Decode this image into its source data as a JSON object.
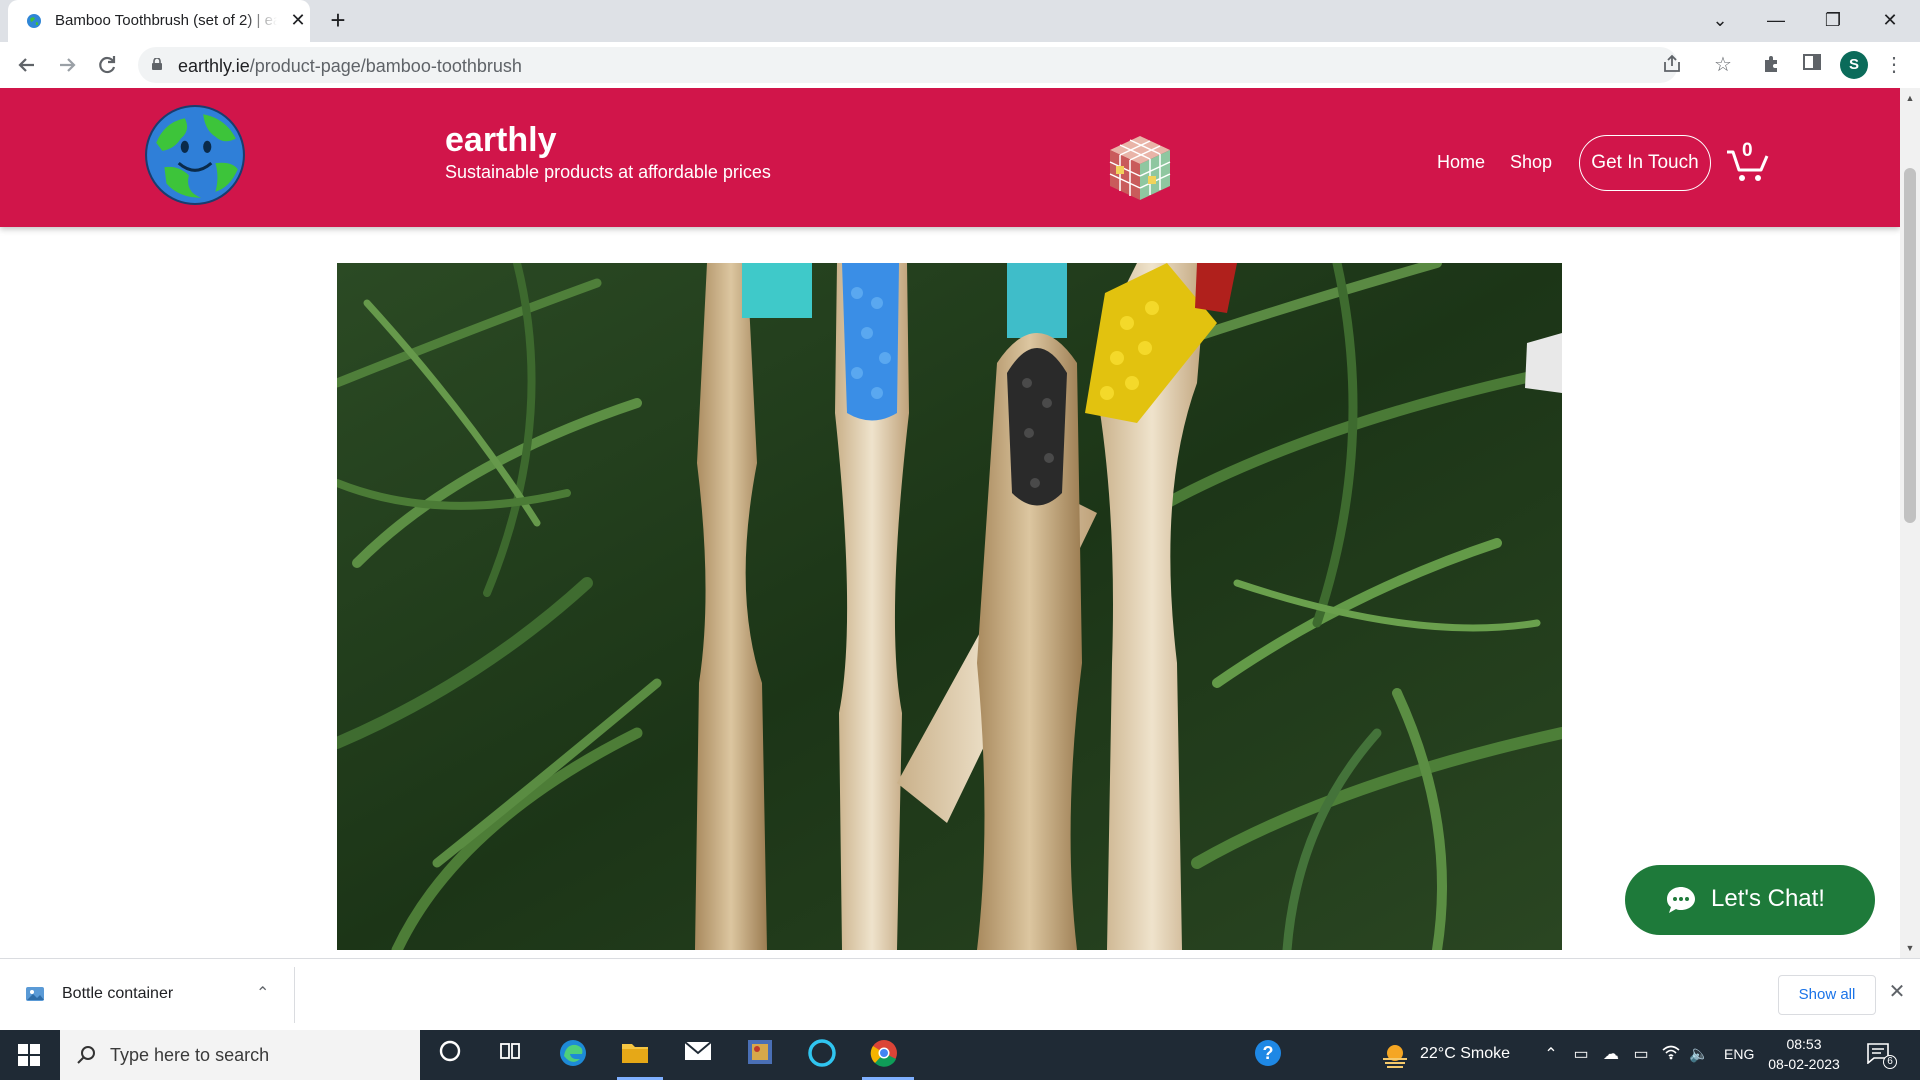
{
  "browser": {
    "tab_title": "Bamboo Toothbrush (set of 2) | earthly",
    "tab_close": "✕",
    "new_tab": "+",
    "url_host": "earthly.ie",
    "url_path": "/product-page/bamboo-toothbrush",
    "profile_initial": "S",
    "window_controls": {
      "tabsearch": "⌄",
      "minimize": "—",
      "restore": "❐",
      "close": "✕"
    }
  },
  "site": {
    "brand": "earthly",
    "tagline": "Sustainable products at affordable prices",
    "nav": {
      "home": "Home",
      "shop": "Shop",
      "contact": "Get In Touch"
    },
    "cart_count": "0",
    "colors": {
      "header": "#d1154a",
      "chat": "#1e7a3a"
    }
  },
  "chat": {
    "label": "Let's Chat!"
  },
  "downloads": {
    "file_name": "Bottle container",
    "show_all": "Show all",
    "close": "✕"
  },
  "taskbar": {
    "search_placeholder": "Type here to search",
    "weather": "22°C  Smoke",
    "language": "ENG",
    "time": "08:53",
    "date": "08-02-2023",
    "notifications": "6"
  }
}
